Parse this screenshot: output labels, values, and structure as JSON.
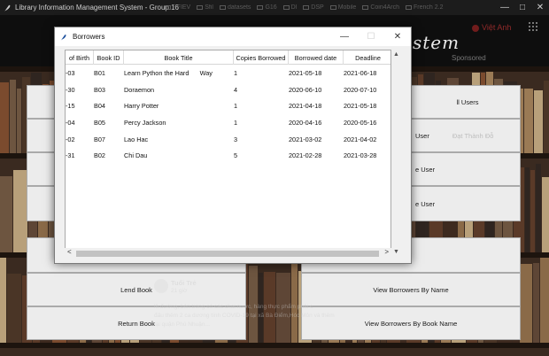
{
  "window": {
    "title": "Library Information Management System - Group 16",
    "controls": {
      "minimize": "—",
      "maximize": "□",
      "close": "✕"
    }
  },
  "ghost_bookmarks": [
    "PFIEV",
    "Sfil",
    "datasets",
    "G16",
    "Dl",
    "DSP",
    "Mobile",
    "Coin4Arch",
    "French 2.2"
  ],
  "header": {
    "heading_fragment": "stem",
    "ghost_user": "Việt Anh",
    "ghost_sponsored": "Sponsored"
  },
  "menu": {
    "right_all_users": "ll Users",
    "right_user_2": "User",
    "right_ghost_name": "Đạt Thành Đỗ",
    "right_user_3": "e User",
    "right_user_4": "e User",
    "lend_book": "Lend Book",
    "view_by_name": "View Borrowers By Name",
    "return_book": "Return Book",
    "view_by_book_name": "View Borrowers By Book Name"
  },
  "ghost_feed": {
    "name": "Tuổi Trẻ",
    "meta": "21 giờ",
    "lines": [
      "lề đường, bên trong có các chai nước, hàng thực phẩm phải c",
      "đấu thêm 2 ca dương tính COVID-19 tại xã Bà Điểm,Hóc Môn và thêm",
      "tại quận Phú Nhuận..."
    ]
  },
  "dialog": {
    "title": "Borrowers",
    "controls": {
      "minimize": "—",
      "maximize": "☐",
      "close": "✕"
    },
    "columns": [
      "of Birth",
      "Book ID",
      "Book Title",
      "Copies Borrowed",
      "Borrowed date",
      "Deadline"
    ],
    "rows": [
      {
        "birth": "-03",
        "book_id": "B01",
        "title": "Learn Python the Hard      Way",
        "copies": "1",
        "borrowed": "2021-05-18",
        "deadline": "2021-06-18"
      },
      {
        "birth": "-30",
        "book_id": "B03",
        "title": "Doraemon",
        "copies": "4",
        "borrowed": "2020-06-10",
        "deadline": "2020-07-10"
      },
      {
        "birth": "-15",
        "book_id": "B04",
        "title": "Harry Potter",
        "copies": "1",
        "borrowed": "2021-04-18",
        "deadline": "2021-05-18"
      },
      {
        "birth": "-04",
        "book_id": "B05",
        "title": "Percy Jackson",
        "copies": "1",
        "borrowed": "2020-04-16",
        "deadline": "2020-05-16"
      },
      {
        "birth": "-02",
        "book_id": "B07",
        "title": "Lao Hac",
        "copies": "3",
        "borrowed": "2021-03-02",
        "deadline": "2021-04-02"
      },
      {
        "birth": "-31",
        "book_id": "B02",
        "title": "Chi Dau",
        "copies": "5",
        "borrowed": "2021-02-28",
        "deadline": "2021-03-28"
      }
    ],
    "scroll": {
      "up": "▲",
      "down": "▼",
      "left": "<",
      "right": ">"
    }
  },
  "colors": {
    "titlebar": "#1c1c1c",
    "header_band": "#0e0e0e",
    "button_bg": "#ececec",
    "dialog_bg": "#f0f0f0",
    "table_bg": "#ffffff"
  }
}
